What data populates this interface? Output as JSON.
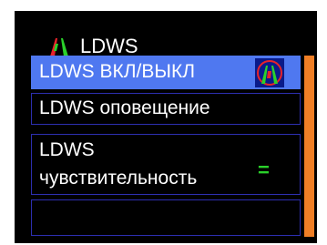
{
  "header": {
    "title": "LDWS",
    "icon": "lane-departure-icon"
  },
  "menu": {
    "items": [
      {
        "label": "LDWS ВКЛ/ВЫКЛ",
        "selected": true,
        "status_icon": "lane-departure-on-icon"
      },
      {
        "label": "LDWS оповещение",
        "selected": false
      },
      {
        "label_line1": "LDWS",
        "label_line2": "чувствительность",
        "value": "=",
        "selected": false
      },
      {
        "label": "",
        "selected": false
      }
    ]
  },
  "colors": {
    "background": "#000000",
    "selected_row": "#4f78f0",
    "row_border": "#2d2fb0",
    "scrollbar": "#f07f26",
    "value_indicator": "#2bd12b",
    "icon_red": "#e8232a",
    "icon_green": "#2bd12b"
  }
}
